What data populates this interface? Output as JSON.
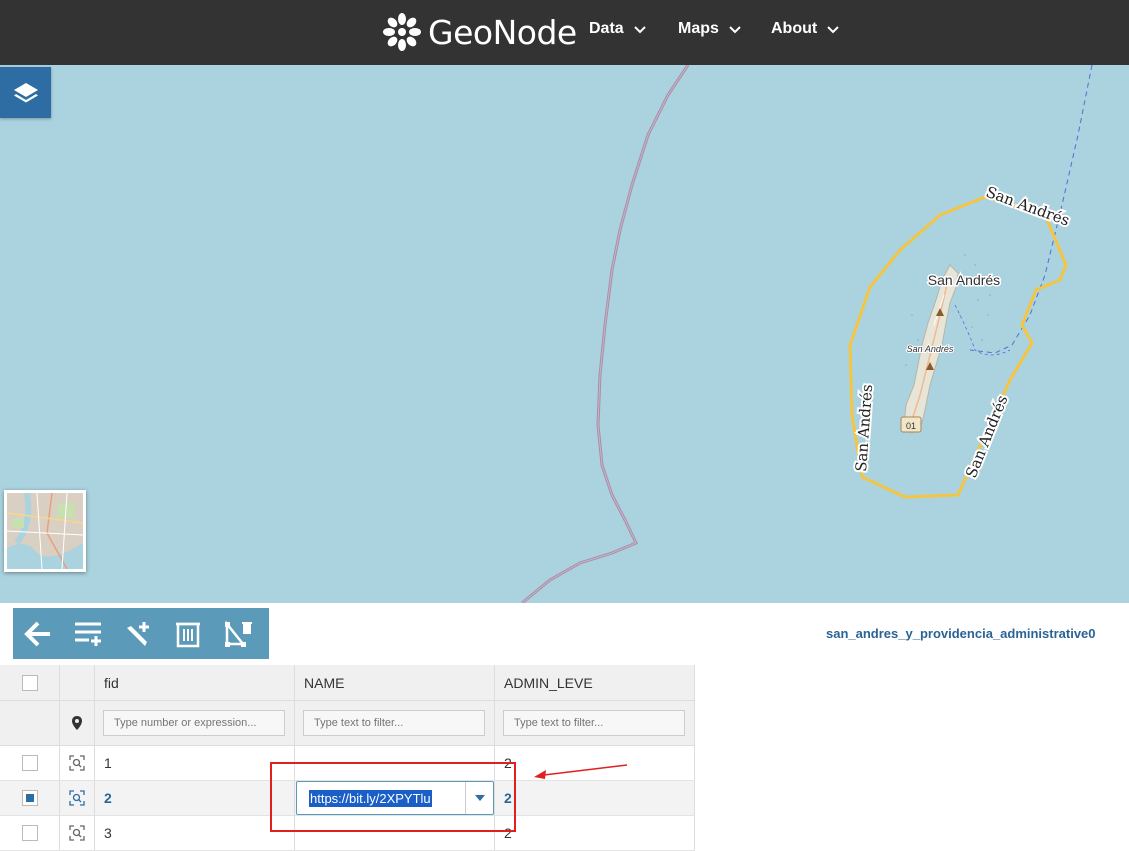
{
  "navbar": {
    "brand": "GeoNode",
    "items": [
      {
        "label": "Data"
      },
      {
        "label": "Maps"
      },
      {
        "label": "About"
      }
    ]
  },
  "map": {
    "labels": {
      "island": "San Andrés",
      "island_small": "San Andrés",
      "road_marker": "01",
      "boundary_top": "San Andrés",
      "boundary_left": "San Andrés",
      "boundary_right": "San Andrés"
    }
  },
  "toolbar": {
    "layer_name": "san_andres_y_providencia_administrative0"
  },
  "grid": {
    "columns": [
      "fid",
      "NAME",
      "ADMIN_LEVE"
    ],
    "filters": {
      "fid": "Type number or expression...",
      "name": "Type text to filter...",
      "admin": "Type text to filter..."
    },
    "rows": [
      {
        "fid": "1",
        "name": "",
        "admin": "2",
        "selected": false
      },
      {
        "fid": "2",
        "name": "https://bit.ly/2XPYTlu",
        "admin": "2",
        "selected": true
      },
      {
        "fid": "3",
        "name": "",
        "admin": "2",
        "selected": false
      }
    ],
    "editor_value": "https://bit.ly/2XPYTlu"
  },
  "colors": {
    "navbar": "#333333",
    "water": "#aad3df",
    "toolbar": "#5b9ab8",
    "boundary": "#f5c542",
    "annotation": "#e02020"
  }
}
